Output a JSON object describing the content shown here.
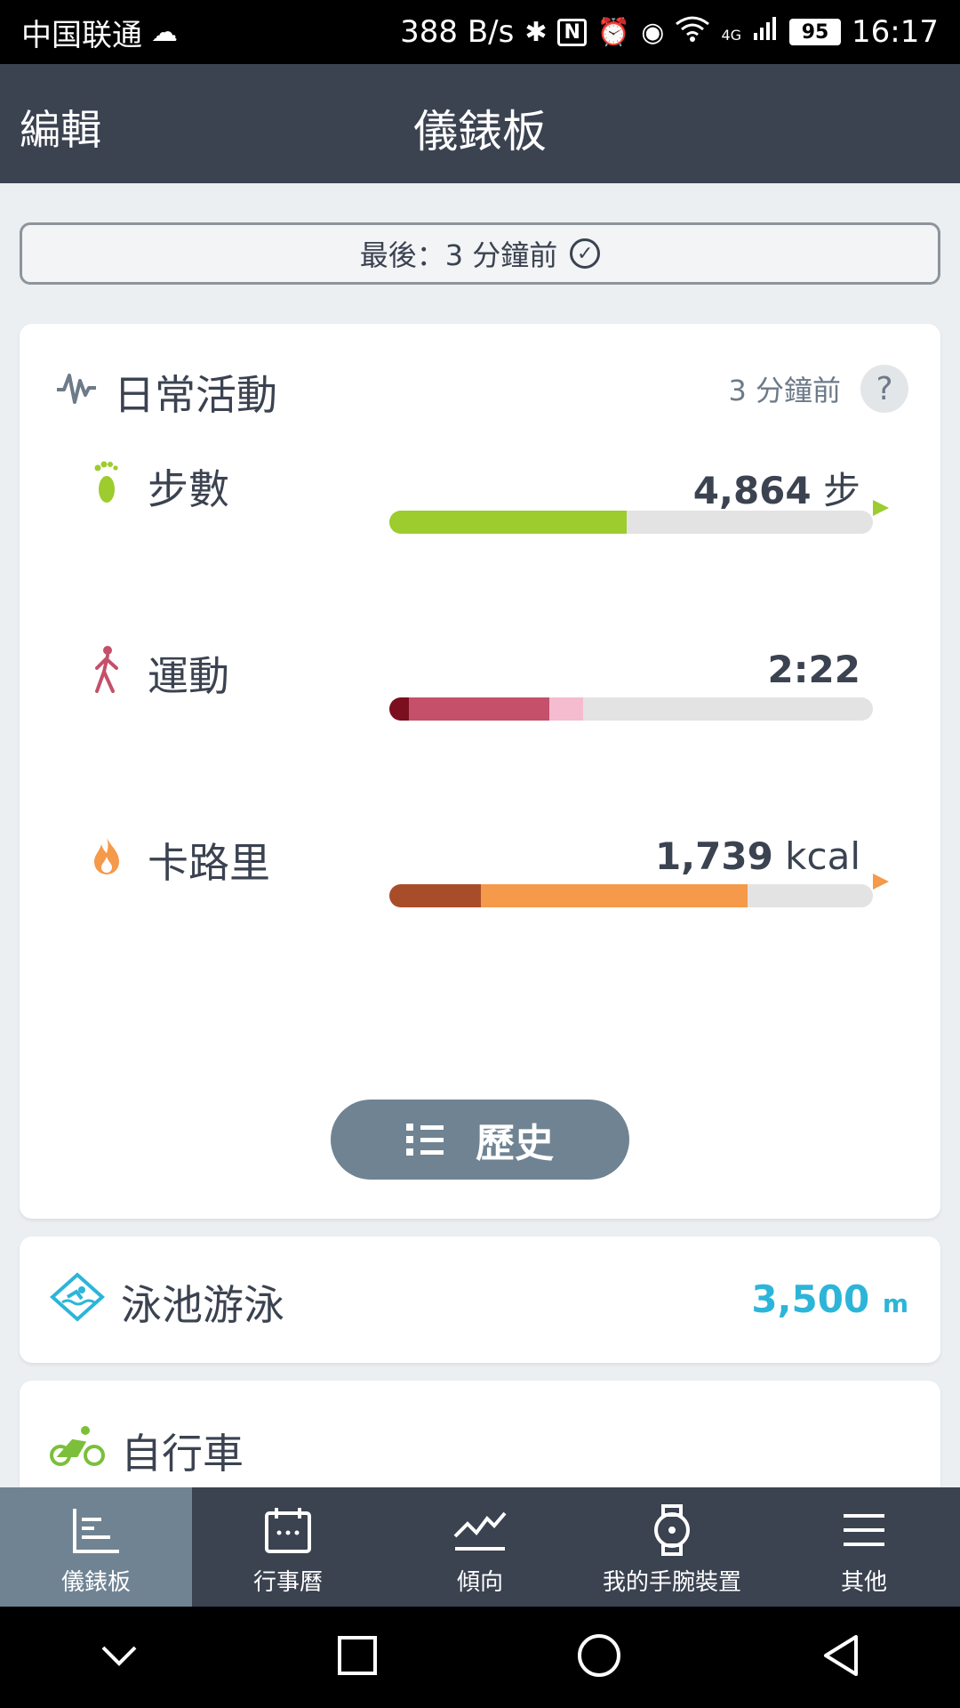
{
  "status_bar": {
    "carrier": "中国联通",
    "net_speed": "388 B/s",
    "signal_type": "4G",
    "battery": "95",
    "time": "16:17"
  },
  "header": {
    "edit_label": "編輯",
    "title": "儀錶板"
  },
  "sync": {
    "text": "最後：3 分鐘前"
  },
  "daily_activity": {
    "title": "日常活動",
    "updated": "3 分鐘前",
    "help": "?",
    "metrics": [
      {
        "label": "步數",
        "value": "4,864",
        "unit": "步",
        "icon": "footprint-icon",
        "color": "#9ccc2d",
        "progress": 0.49
      },
      {
        "label": "運動",
        "value": "2:22",
        "unit": "",
        "icon": "walking-person-icon",
        "colors": [
          "#7b0f1f",
          "#c4506a",
          "#f5bcd0"
        ],
        "progress_segments": [
          0.04,
          0.29,
          0.07
        ]
      },
      {
        "label": "卡路里",
        "value": "1,739",
        "unit": "kcal",
        "icon": "flame-icon",
        "colors": [
          "#a84d2a",
          "#f5994a"
        ],
        "progress_segments": [
          0.19,
          0.55
        ]
      }
    ],
    "history_button": "歷史"
  },
  "swim": {
    "title": "泳池游泳",
    "value": "3,500",
    "unit": "m",
    "icon": "swimming-icon",
    "color": "#2cb5d8"
  },
  "bike": {
    "title": "自行車",
    "icon": "cycling-icon",
    "color": "#7bbf3a"
  },
  "bottom_nav": {
    "items": [
      {
        "label": "儀錶板",
        "icon": "dashboard-icon",
        "active": true
      },
      {
        "label": "行事曆",
        "icon": "calendar-icon",
        "active": false
      },
      {
        "label": "傾向",
        "icon": "trend-icon",
        "active": false
      },
      {
        "label": "我的手腕裝置",
        "icon": "watch-icon",
        "active": false
      },
      {
        "label": "其他",
        "icon": "menu-icon",
        "active": false
      }
    ]
  }
}
